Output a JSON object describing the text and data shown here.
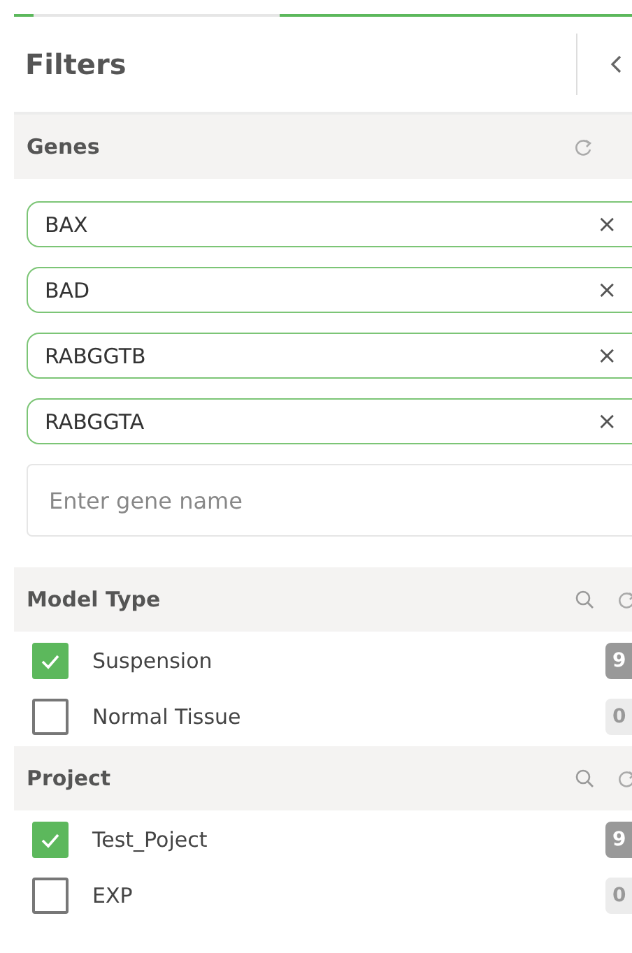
{
  "panel": {
    "title": "Filters"
  },
  "genes": {
    "title": "Genes",
    "chips": [
      {
        "label": "BAX",
        "remove": "×"
      },
      {
        "label": "BAD",
        "remove": "×"
      },
      {
        "label": "RABGGTB",
        "remove": "×"
      },
      {
        "label": "RABGGTA",
        "remove": "×"
      }
    ],
    "input": {
      "placeholder": "Enter gene name"
    }
  },
  "groups": [
    {
      "title": "Model Type",
      "options": [
        {
          "label": "Suspension",
          "checked": true,
          "count": "9"
        },
        {
          "label": "Normal Tissue",
          "checked": false,
          "count": "0"
        }
      ]
    },
    {
      "title": "Project",
      "options": [
        {
          "label": "Test_Poject",
          "checked": true,
          "count": "9"
        },
        {
          "label": "EXP",
          "checked": false,
          "count": "0"
        }
      ]
    }
  ]
}
